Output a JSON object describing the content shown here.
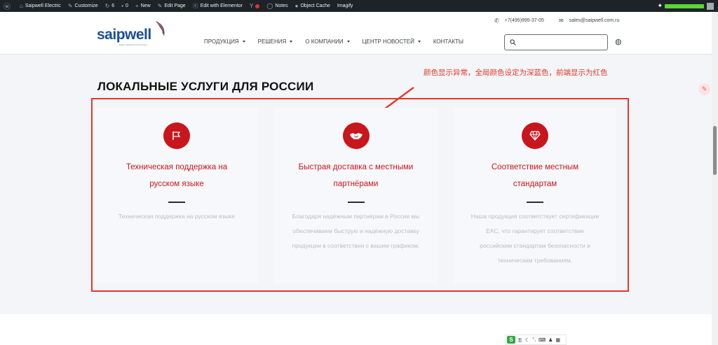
{
  "admin_bar": {
    "site": "Saipwell Electric",
    "customize": "Customize",
    "updates": "6",
    "comments": "0",
    "new": "New",
    "edit_page": "Edit Page",
    "elementor": "Edit with Elementor",
    "yoast": "Y",
    "notes": "Notes",
    "object_cache": "Object Cache",
    "imagify": "Imagify"
  },
  "header": {
    "logo": "saipwell",
    "logo_sub": "Better Solutions for the Future",
    "phone": "+7(495)995-37-05",
    "email": "sales@saipwell.com.ru",
    "nav": [
      {
        "label": "ПРОДУКЦИЯ",
        "dropdown": true
      },
      {
        "label": "РЕШЕНИЯ",
        "dropdown": true
      },
      {
        "label": "О КОМПАНИИ",
        "dropdown": true
      },
      {
        "label": "ЦЕНТР НОВОСТЕЙ",
        "dropdown": true
      },
      {
        "label": "КОНТАКТЫ",
        "dropdown": false
      }
    ],
    "search_placeholder": ""
  },
  "annotation": {
    "note": "颜色显示异常，全局颜色设定为深蓝色，前端显示为红色"
  },
  "section": {
    "title": "ЛОКАЛЬНЫЕ УСЛУГИ ДЛЯ РОССИИ",
    "cards": [
      {
        "icon": "flag-icon",
        "title": "Техническая поддержка на русском языке",
        "text": "Техническая поддержка на русском языке"
      },
      {
        "icon": "handshake-icon",
        "title": "Быстрая доставка с местными партнёрами",
        "text": "Благодаря надёжным партнёрам в России мы обеспечиваем быструю и надёжную доставку продукции в соответствии с вашим графиком."
      },
      {
        "icon": "diamond-icon",
        "title": "Соответствие местным стандартам",
        "text": "Наша продукция соответствует сертификации EAC, что гарантирует соответствие российским стандартам безопасности и техническим требованиям."
      }
    ]
  },
  "ime": {
    "label": "S",
    "mode": "五"
  },
  "colors": {
    "accent_red": "#c8161d",
    "annotation_red": "#e5362b",
    "brand_blue": "#1b4f93"
  }
}
